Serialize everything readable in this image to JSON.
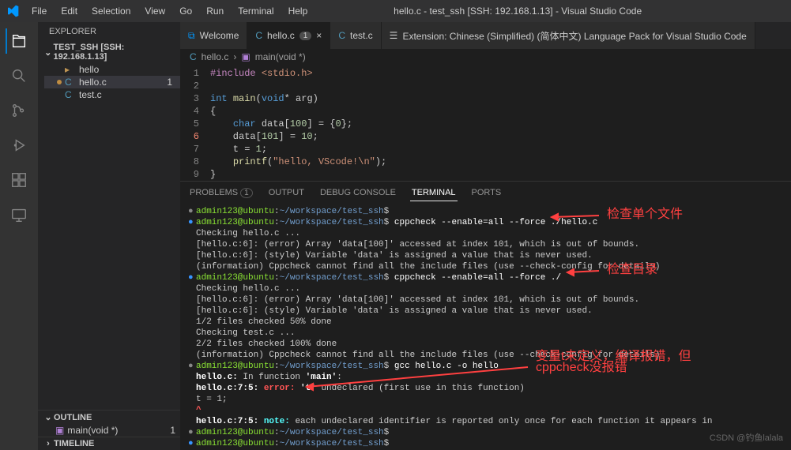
{
  "window": {
    "title": "hello.c - test_ssh [SSH: 192.168.1.13] - Visual Studio Code"
  },
  "menu": [
    "File",
    "Edit",
    "Selection",
    "View",
    "Go",
    "Run",
    "Terminal",
    "Help"
  ],
  "sidebar": {
    "title": "EXPLORER",
    "workspace": "TEST_SSH [SSH: 192.168.1.13]",
    "files": [
      {
        "name": "hello",
        "icon": "folder"
      },
      {
        "name": "hello.c",
        "icon": "C",
        "badge": "1",
        "modified": true
      },
      {
        "name": "test.c",
        "icon": "C"
      }
    ],
    "outline_title": "OUTLINE",
    "outline_item": "main(void *)",
    "outline_badge": "1",
    "timeline_title": "TIMELINE"
  },
  "tabs": [
    {
      "label": "Welcome",
      "type": "welcome"
    },
    {
      "label": "hello.c",
      "type": "c",
      "badge": "1",
      "close": true,
      "active": true
    },
    {
      "label": "test.c",
      "type": "c"
    },
    {
      "label": "Extension: Chinese (Simplified) (简体中文) Language Pack for Visual Studio Code",
      "type": "ext"
    }
  ],
  "breadcrumb": {
    "file": "hello.c",
    "symbol": "main(void *)"
  },
  "code": {
    "lines": [
      {
        "n": "1",
        "html": "<span class='pp'>#include</span> <span class='str'>&lt;stdio.h&gt;</span>"
      },
      {
        "n": "2",
        "html": ""
      },
      {
        "n": "3",
        "html": "<span class='kw'>int</span> <span class='fn'>main</span>(<span class='kw'>void</span>* arg)"
      },
      {
        "n": "4",
        "html": "{"
      },
      {
        "n": "5",
        "html": "    <span class='kw'>char</span> data[<span class='num-lit'>100</span>] = {<span class='num-lit'>0</span>};"
      },
      {
        "n": "6",
        "html": "    data[<span class='num-lit'>101</span>] = <span class='num-lit'>10</span>;",
        "err": true
      },
      {
        "n": "7",
        "html": "    t = <span class='num-lit'>1</span>;"
      },
      {
        "n": "8",
        "html": "    <span class='fn'>printf</span>(<span class='str'>\"hello, VScode!\\n\"</span>);"
      },
      {
        "n": "9",
        "html": "}"
      }
    ]
  },
  "panel": {
    "tabs": [
      {
        "label": "PROBLEMS",
        "count": "1"
      },
      {
        "label": "OUTPUT"
      },
      {
        "label": "DEBUG CONSOLE"
      },
      {
        "label": "TERMINAL",
        "active": true
      },
      {
        "label": "PORTS"
      }
    ]
  },
  "terminal": {
    "prompt_user": "admin123@ubuntu",
    "prompt_path": "~/workspace/test_ssh",
    "lines": [
      {
        "type": "prompt",
        "bullet": "dim",
        "cmd": ""
      },
      {
        "type": "prompt",
        "bullet": "on",
        "cmd": "cppcheck --enable=all --force ./hello.c"
      },
      {
        "type": "out",
        "text": "Checking hello.c ..."
      },
      {
        "type": "out",
        "text": "[hello.c:6]: (error) Array 'data[100]' accessed at index 101, which is out of bounds."
      },
      {
        "type": "out",
        "text": "[hello.c:6]: (style) Variable 'data' is assigned a value that is never used."
      },
      {
        "type": "out",
        "text": "(information) Cppcheck cannot find all the include files (use --check-config for details)"
      },
      {
        "type": "prompt",
        "bullet": "on",
        "cmd": "cppcheck --enable=all --force ./"
      },
      {
        "type": "out",
        "text": "Checking hello.c ..."
      },
      {
        "type": "out",
        "text": "[hello.c:6]: (error) Array 'data[100]' accessed at index 101, which is out of bounds."
      },
      {
        "type": "out",
        "text": "[hello.c:6]: (style) Variable 'data' is assigned a value that is never used."
      },
      {
        "type": "out",
        "text": "1/2 files checked 50% done"
      },
      {
        "type": "out",
        "text": "Checking test.c ..."
      },
      {
        "type": "out",
        "text": "2/2 files checked 100% done"
      },
      {
        "type": "out",
        "text": "(information) Cppcheck cannot find all the include files (use --check-config for details)"
      },
      {
        "type": "prompt",
        "bullet": "dim",
        "cmd": "gcc hello.c -o hello"
      },
      {
        "type": "raw",
        "html": "<span class='bold'>hello.c:</span> In function <span class='bold'>'main'</span>:"
      },
      {
        "type": "raw",
        "html": "<span class='bold'>hello.c:7:5:</span> <span class='err-txt'>error:</span> <span class='bold'>'t'</span> undeclared (first use in this function)"
      },
      {
        "type": "out",
        "text": "     t = 1;"
      },
      {
        "type": "raw",
        "html": "     <span class='err-txt'>^</span>"
      },
      {
        "type": "raw",
        "html": "<span class='bold'>hello.c:7:5:</span> <span class='note-txt'>note:</span> each undeclared identifier is reported only once for each function it appears in"
      },
      {
        "type": "prompt",
        "bullet": "dim",
        "cmd": ""
      },
      {
        "type": "prompt",
        "bullet": "on",
        "cmd": ""
      }
    ]
  },
  "annotations": {
    "a1": "检查单个文件",
    "a2": "检查目录",
    "a3_l1": "变量t未定义，编译报错，但",
    "a3_l2": "cppcheck没报错"
  },
  "watermark": "CSDN @钓鱼lalala",
  "watermark2": ""
}
